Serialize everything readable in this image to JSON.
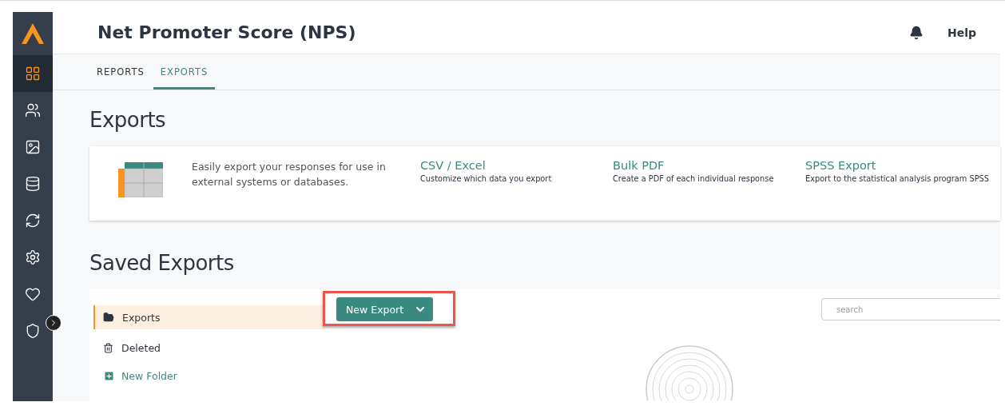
{
  "sidebar": {
    "items": [
      {
        "selected": true
      },
      {
        "selected": false
      },
      {
        "selected": false
      },
      {
        "selected": false
      },
      {
        "selected": false
      },
      {
        "selected": false
      },
      {
        "selected": false
      },
      {
        "selected": false
      }
    ]
  },
  "header": {
    "title": "Net Promoter Score (NPS)",
    "help": "Help"
  },
  "tabs": [
    {
      "label": "REPORTS",
      "selected": false
    },
    {
      "label": "EXPORTS",
      "selected": true
    }
  ],
  "exports": {
    "heading": "Exports",
    "description": "Easily export your responses for use in external systems or databases.",
    "options": [
      {
        "title": "CSV / Excel",
        "subtitle": "Customize which data you export"
      },
      {
        "title": "Bulk PDF",
        "subtitle": "Create a PDF of each individual response"
      },
      {
        "title": "SPSS Export",
        "subtitle": "Export to the statistical analysis program SPSS"
      }
    ]
  },
  "saved_exports": {
    "heading": "Saved Exports",
    "folders": [
      {
        "label": "Exports",
        "kind": "folder",
        "selected": true
      },
      {
        "label": "Deleted",
        "kind": "trash",
        "selected": false
      }
    ],
    "new_folder": "New Folder",
    "new_export": "New Export",
    "search": {
      "placeholder": "search"
    }
  }
}
